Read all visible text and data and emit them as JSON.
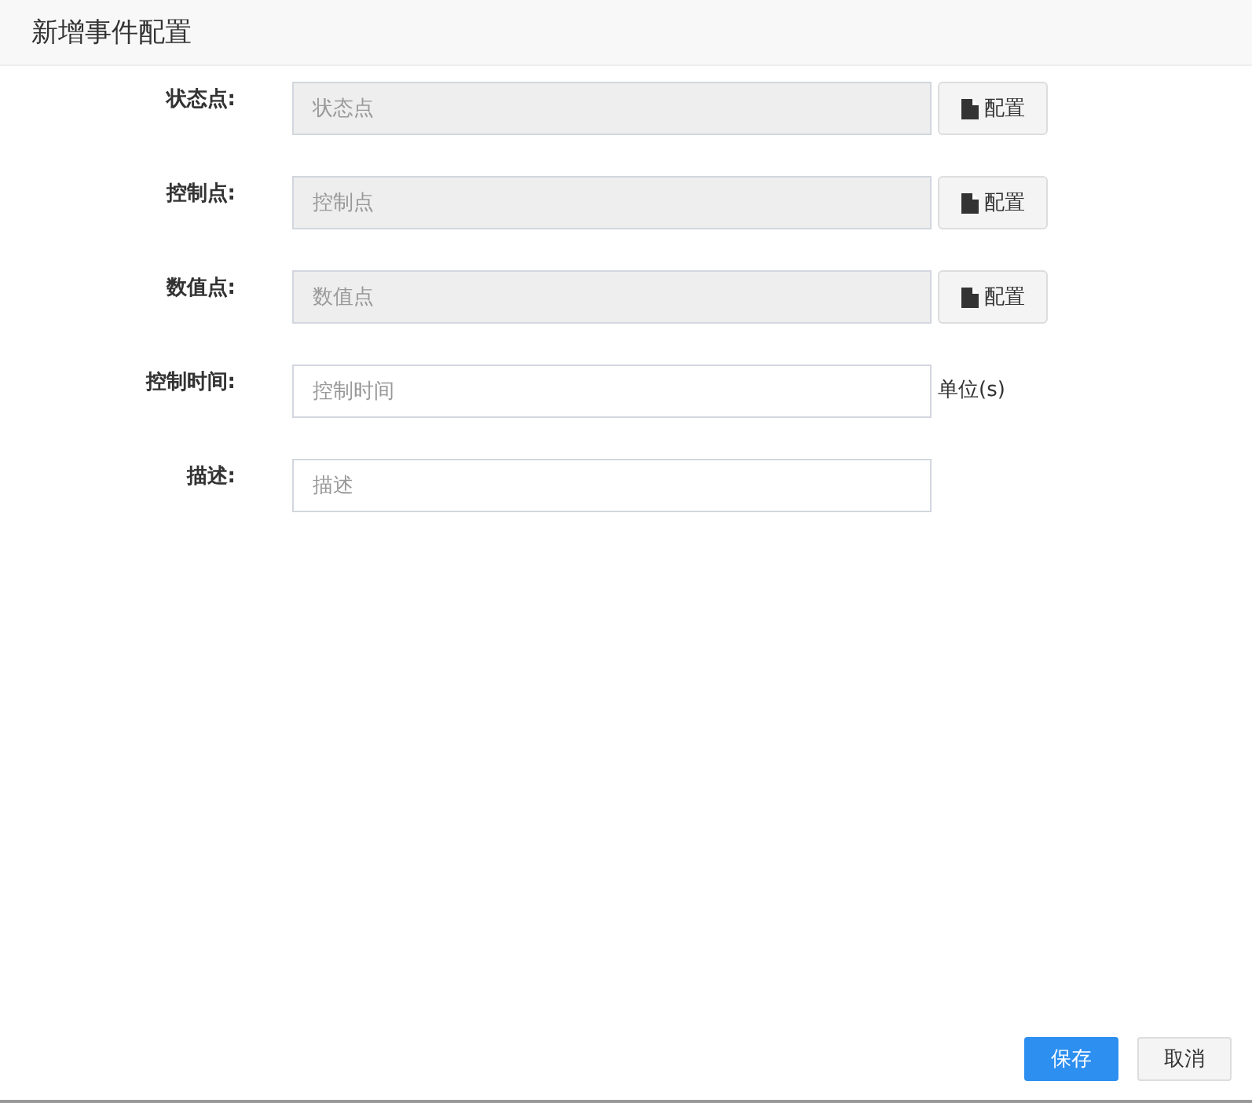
{
  "window": {
    "title": "新增事件配置"
  },
  "fields": [
    {
      "kind": "picker",
      "label": "状态点:",
      "placeholder": "状态点",
      "disabled": true,
      "button": "配置"
    },
    {
      "kind": "picker",
      "label": "控制点:",
      "placeholder": "控制点",
      "disabled": true,
      "button": "配置"
    },
    {
      "kind": "picker",
      "label": "数值点:",
      "placeholder": "数值点",
      "disabled": true,
      "button": "配置"
    },
    {
      "kind": "unit",
      "label": "控制时间:",
      "placeholder": "控制时间",
      "disabled": false,
      "unit": "单位(s)"
    },
    {
      "kind": "text",
      "label": "描述:",
      "placeholder": "描述",
      "disabled": false
    }
  ],
  "buttons": [
    {
      "kind": "primary",
      "label": "保存"
    },
    {
      "kind": "default",
      "label": "取消"
    }
  ]
}
